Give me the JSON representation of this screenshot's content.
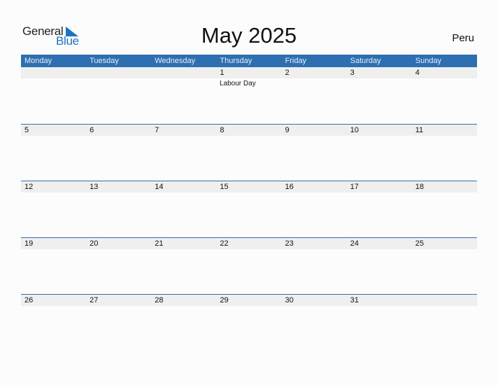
{
  "logo": {
    "general": "General",
    "blue": "Blue"
  },
  "title": "May 2025",
  "country": "Peru",
  "weekdays": [
    "Monday",
    "Tuesday",
    "Wednesday",
    "Thursday",
    "Friday",
    "Saturday",
    "Sunday"
  ],
  "weeks": [
    [
      "",
      "",
      "",
      "1",
      "2",
      "3",
      "4"
    ],
    [
      "5",
      "6",
      "7",
      "8",
      "9",
      "10",
      "11"
    ],
    [
      "12",
      "13",
      "14",
      "15",
      "16",
      "17",
      "18"
    ],
    [
      "19",
      "20",
      "21",
      "22",
      "23",
      "24",
      "25"
    ],
    [
      "26",
      "27",
      "28",
      "29",
      "30",
      "31",
      ""
    ]
  ],
  "holidays": [
    {
      "day": "1",
      "name": "Labour Day"
    }
  ],
  "colors": {
    "header": "#2e6fb1",
    "accent": "#1a73c4"
  }
}
